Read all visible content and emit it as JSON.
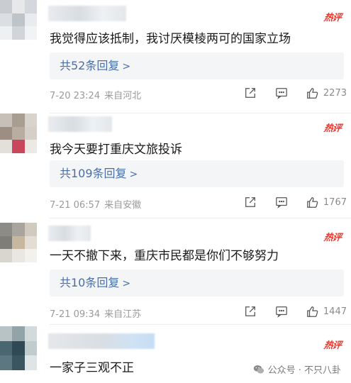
{
  "comments": [
    {
      "text": "我觉得应该抵制，我讨厌模棱两可的国家立场",
      "reply_label": "共52条回复",
      "time": "7-20 23:24",
      "location": "来自河北",
      "likes": "2273",
      "hot_label": "热评"
    },
    {
      "text": "我今天要打重庆文旅投诉",
      "reply_label": "共109条回复",
      "time": "7-21 06:57",
      "location": "来自安徽",
      "likes": "1767",
      "hot_label": "热评"
    },
    {
      "text": "一天不撤下来，重庆市民都是你们不够努力",
      "reply_label": "共10条回复",
      "time": "7-21 09:34",
      "location": "来自江苏",
      "likes": "1447",
      "hot_label": "热评"
    },
    {
      "text": "一家子三观不正",
      "hot_label": "热评"
    }
  ],
  "reply_chevron": ">",
  "watermark": "公众号 · 不只八卦",
  "icons": {
    "share": "share-icon",
    "reply": "comment-icon",
    "like": "thumbs-up-icon",
    "watermark": "wechat-icon"
  },
  "colors": {
    "hot": "#e5392f",
    "link": "#4a6ea6",
    "meta": "#9a9a9a"
  }
}
